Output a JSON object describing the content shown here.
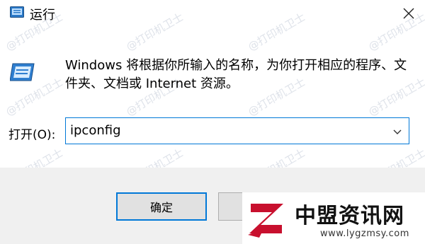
{
  "window": {
    "title": "运行"
  },
  "watermark": "@打印机卫士",
  "description": "Windows 将根据你所输入的名称，为你打开相应的程序、文件夹、文档或 Internet 资源。",
  "open": {
    "label": "打开(O):",
    "value": "ipconfig"
  },
  "buttons": {
    "ok": "确定",
    "cancel": "",
    "browse": ""
  },
  "brand": {
    "name": "中盟资讯网",
    "url": "www.lygzmsy.com"
  }
}
